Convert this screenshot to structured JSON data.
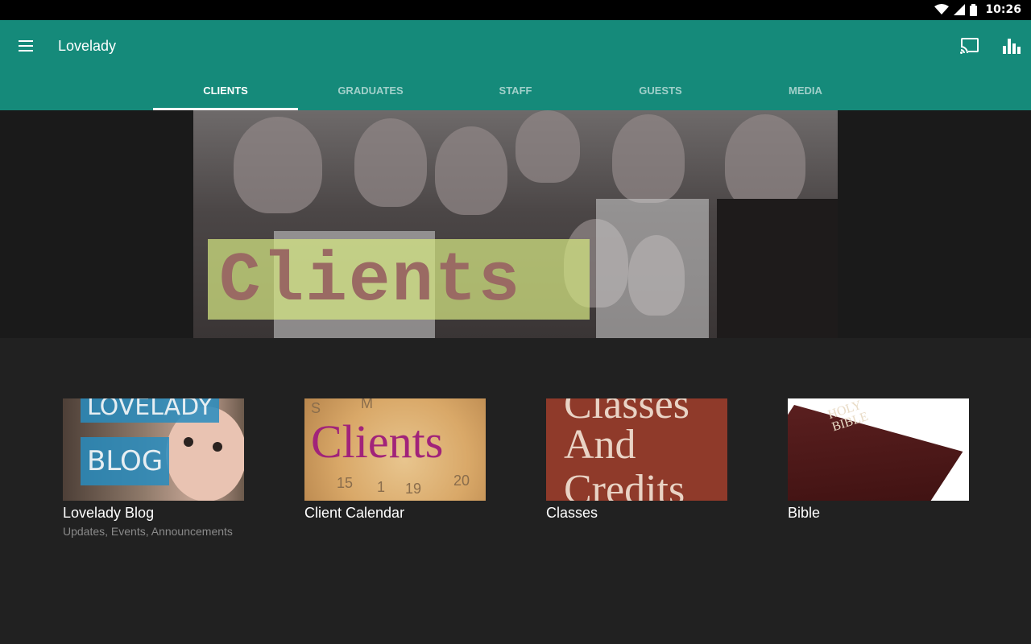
{
  "status_bar": {
    "time": "10:26",
    "icons": [
      "wifi-icon",
      "signal-icon",
      "battery-icon"
    ]
  },
  "app_bar": {
    "title": "Lovelady",
    "color": "#158a7a",
    "icons": [
      "menu-icon",
      "cast-icon",
      "bar-chart-icon"
    ]
  },
  "tabs": [
    {
      "label": "CLIENTS",
      "active": true
    },
    {
      "label": "GRADUATES",
      "active": false
    },
    {
      "label": "STAFF",
      "active": false
    },
    {
      "label": "GUESTS",
      "active": false
    },
    {
      "label": "MEDIA",
      "active": false
    }
  ],
  "banner": {
    "label": "Clients"
  },
  "cards": [
    {
      "title": "Lovelady Blog",
      "subtitle": "Updates, Events, Announcements",
      "image_text": [
        "LOVELADY",
        "BLOG"
      ]
    },
    {
      "title": "Client Calendar",
      "subtitle": "",
      "image_text": [
        "Clients"
      ]
    },
    {
      "title": "Classes",
      "subtitle": "",
      "image_text": [
        "Classes",
        "And",
        "Credits"
      ]
    },
    {
      "title": "Bible",
      "subtitle": "",
      "image_text": [
        "HOLY",
        "BIBLE"
      ]
    }
  ]
}
